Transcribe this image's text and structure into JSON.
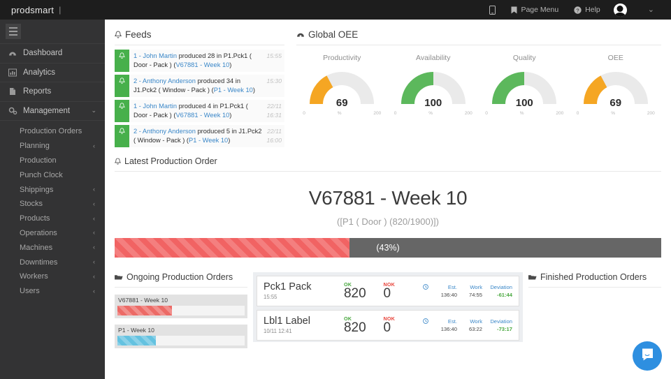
{
  "topbar": {
    "brand": "prodsmart",
    "brand_separator": "|",
    "items": [
      {
        "label": "",
        "icon": "mobile-icon"
      },
      {
        "label": "Page Menu",
        "icon": "bookmark-icon"
      },
      {
        "label": "Help",
        "icon": "help-circle-icon"
      }
    ],
    "avatar": "user-avatar",
    "caret": "⌄"
  },
  "sidebar": {
    "menu_toggle": "hamburger-icon",
    "items": [
      {
        "label": "Dashboard",
        "icon": "dashboard-icon",
        "chevron": ""
      },
      {
        "label": "Analytics",
        "icon": "bar-chart-icon",
        "chevron": ""
      },
      {
        "label": "Reports",
        "icon": "document-icon",
        "chevron": ""
      },
      {
        "label": "Management",
        "icon": "gears-icon",
        "chevron": "⌄"
      }
    ],
    "sub_items": [
      {
        "label": "Production Orders",
        "chevron": ""
      },
      {
        "label": "Planning",
        "chevron": "‹"
      },
      {
        "label": "Production",
        "chevron": ""
      },
      {
        "label": "Punch Clock",
        "chevron": ""
      },
      {
        "label": "Shippings",
        "chevron": "‹"
      },
      {
        "label": "Stocks",
        "chevron": "‹"
      },
      {
        "label": "Products",
        "chevron": "‹"
      },
      {
        "label": "Operations",
        "chevron": "‹"
      },
      {
        "label": "Machines",
        "chevron": "‹"
      },
      {
        "label": "Downtimes",
        "chevron": "‹"
      },
      {
        "label": "Workers",
        "chevron": "‹"
      },
      {
        "label": "Users",
        "chevron": "‹"
      }
    ]
  },
  "feeds": {
    "title": "Feeds",
    "icon": "bell-icon",
    "entries": [
      {
        "user_id": "1 - John Martin",
        "action": " produced 28 in P1.Pck1 ( Door - Pack ) (",
        "order": "V67881 - Week 10",
        "close": ")",
        "time1": "15:55",
        "time2": ""
      },
      {
        "user_id": "2 - Anthony Anderson",
        "action": " produced 34 in J1.Pck2 ( Window - Pack ) (",
        "order": "P1 - Week 10",
        "close": ")",
        "time1": "15:30",
        "time2": ""
      },
      {
        "user_id": "1 - John Martin",
        "action": " produced 4 in P1.Pck1 ( Door - Pack ) (",
        "order": "V67881 - Week 10",
        "close": ")",
        "time1": "22/11",
        "time2": "16:31"
      },
      {
        "user_id": "2 - Anthony Anderson",
        "action": " produced 5 in J1.Pck2 ( Window - Pack ) (",
        "order": "P1 - Week 10",
        "close": ")",
        "time1": "22/11",
        "time2": "16:00"
      }
    ]
  },
  "oee": {
    "title": "Global OEE",
    "icon": "speedometer-icon"
  },
  "chart_data": {
    "type": "bar",
    "title": "Global OEE",
    "subtitle": "",
    "xlabel": "",
    "ylabel": "%",
    "ylim": [
      0,
      200
    ],
    "grid": false,
    "legend": "none",
    "categories": [
      "Productivity",
      "Availability",
      "Quality",
      "OEE"
    ],
    "values": [
      69,
      100,
      100,
      69
    ],
    "gauges": [
      {
        "label": "Productivity",
        "value": 69,
        "min": 0,
        "max": 200,
        "unit": "%",
        "color": "#f5a623"
      },
      {
        "label": "Availability",
        "value": 100,
        "min": 0,
        "max": 200,
        "unit": "%",
        "color": "#5cb85c"
      },
      {
        "label": "Quality",
        "value": 100,
        "min": 0,
        "max": 200,
        "unit": "%",
        "color": "#5cb85c"
      },
      {
        "label": "OEE",
        "value": 69,
        "min": 0,
        "max": 200,
        "unit": "%",
        "color": "#f5a623"
      }
    ],
    "tick_min": "0",
    "tick_mid": "%",
    "tick_max": "200"
  },
  "latest_order": {
    "panel_title": "Latest Production Order",
    "icon": "bell-icon",
    "title": "V67881 - Week 10",
    "subtitle": "([P1 ( Door ) (820/1900)])",
    "progress_percent": 43,
    "progress_label": "(43%)",
    "progress_color": "#f16363"
  },
  "ongoing": {
    "title": "Ongoing Production Orders",
    "icon": "folder-icon",
    "items": [
      {
        "label": "V67881 - Week 10",
        "percent": 43,
        "color": "#ec6a66"
      },
      {
        "label": "P1 - Week 10",
        "percent": 30,
        "color": "#64c2e0"
      }
    ]
  },
  "finished": {
    "title": "Finished Production Orders",
    "icon": "folder-icon",
    "items": []
  },
  "order_cards": {
    "col_est": "Est.",
    "col_work": "Work",
    "col_deviation": "Deviation",
    "clock_icon": "clock-icon",
    "ok_label": "OK",
    "nok_label": "NOK",
    "rows": [
      {
        "name": "Pck1 Pack",
        "time": "15:55",
        "ok": "820",
        "nok": "0",
        "est": "136:40",
        "work": "74:55",
        "deviation": "-61:44"
      },
      {
        "name": "Lbl1 Label",
        "time": "10/11 12:41",
        "ok": "820",
        "nok": "0",
        "est": "136:40",
        "work": "63:22",
        "deviation": "-73:17"
      }
    ]
  },
  "intercom": {
    "icon": "chat-bubble-icon",
    "color": "#2e8fe0"
  }
}
